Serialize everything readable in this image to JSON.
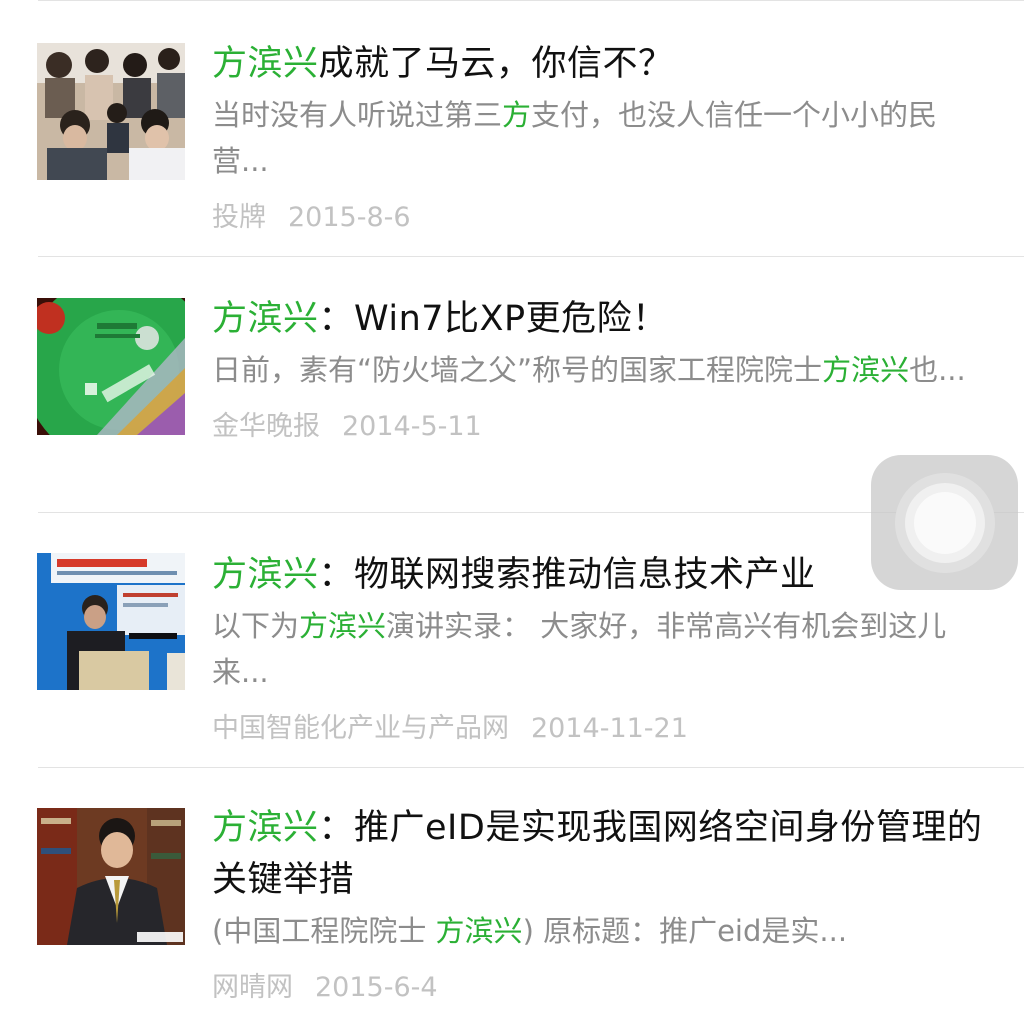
{
  "results": [
    {
      "title_highlight": "方滨兴",
      "title_rest": "成就了马云，你信不？",
      "snippet_before": "当时没有人听说过第三",
      "snippet_highlight": "方",
      "snippet_after": "支付，也没人信任一个小小的民营...",
      "source": "投牌",
      "date": "2015-8-6",
      "thumb_icon": "people-crowd-photo"
    },
    {
      "title_highlight": "方滨兴",
      "title_rest": "：Win7比XP更危险！",
      "snippet_before": "日前，素有“防火墙之父”称号的国家工程院院士",
      "snippet_highlight": "方滨兴",
      "snippet_after": "也...",
      "source": "金华晚报",
      "date": "2014-5-11",
      "thumb_icon": "windows-disc-photo"
    },
    {
      "title_highlight": "方滨兴",
      "title_rest": "：物联网搜索推动信息技术产业",
      "snippet_before": "以下为",
      "snippet_highlight": "方滨兴",
      "snippet_after": "演讲实录： 大家好，非常高兴有机会到这儿来...",
      "source": "中国智能化产业与产品网",
      "date": "2014-11-21",
      "thumb_icon": "speaker-podium-photo"
    },
    {
      "title_highlight": "方滨兴",
      "title_rest": "：推广eID是实现我国网络空间身份管理的关键举措",
      "snippet_before": "(中国工程院院士 ",
      "snippet_highlight": "方滨兴",
      "snippet_after": ") 原标题：推广eid是实...",
      "source": "网晴网",
      "date": "2015-6-4",
      "thumb_icon": "portrait-photo"
    }
  ],
  "colors": {
    "highlight": "#2bb035",
    "title": "#111111",
    "snippet": "#8c8c8c",
    "meta": "#c2c2c2"
  },
  "overlay": {
    "icon": "assistive-touch-icon"
  }
}
